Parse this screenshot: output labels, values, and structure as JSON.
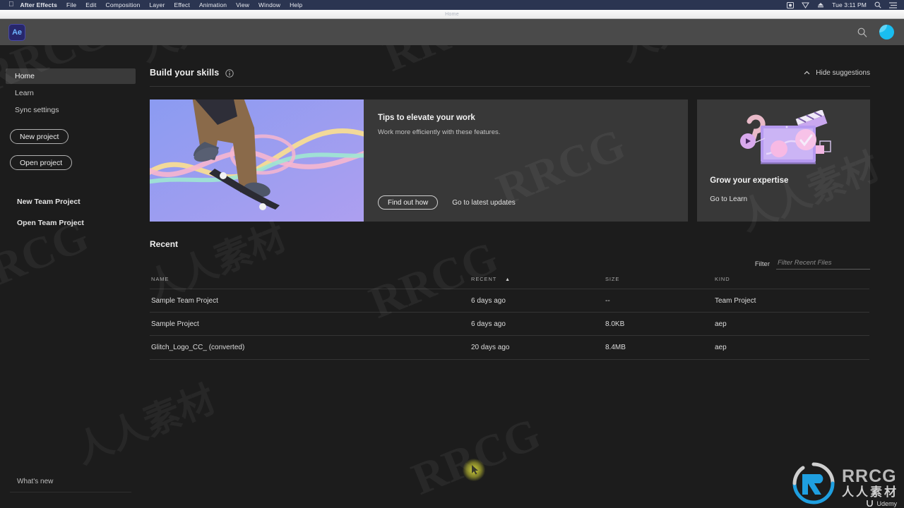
{
  "macbar": {
    "apple_icon": "apple-icon",
    "app_name": "After Effects",
    "menus": [
      "File",
      "Edit",
      "Composition",
      "Layer",
      "Effect",
      "Animation",
      "View",
      "Window",
      "Help"
    ],
    "status_icons": [
      "screen-record-icon",
      "shield-icon",
      "eject-icon"
    ],
    "clock": "Tue 3:11 PM",
    "right_icons": [
      "spotlight-search-icon",
      "control-center-icon"
    ]
  },
  "window": {
    "title": "Home"
  },
  "toolbar": {
    "logo_text": "Ae",
    "search_icon": "search-icon",
    "avatar": "user-avatar"
  },
  "sidebar": {
    "items": [
      {
        "label": "Home",
        "active": true
      },
      {
        "label": "Learn",
        "active": false
      },
      {
        "label": "Sync settings",
        "active": false
      }
    ],
    "buttons": [
      {
        "label": "New project"
      },
      {
        "label": "Open project"
      }
    ],
    "team_links": [
      {
        "label": "New Team Project"
      },
      {
        "label": "Open Team Project"
      }
    ],
    "whats_new": "What's new"
  },
  "suggestions": {
    "title": "Build your skills",
    "info_icon": "info-icon",
    "hide_label": "Hide suggestions",
    "hide_icon": "chevron-up-icon",
    "tips_card": {
      "title": "Tips to elevate your work",
      "subtitle": "Work more efficiently with these features.",
      "primary_button": "Find out how",
      "secondary_link": "Go to latest updates",
      "hero_alt": "skateboarder-hero-image"
    },
    "grow_card": {
      "title": "Grow your expertise",
      "link": "Go to Learn",
      "art_alt": "learning-illustration"
    }
  },
  "recent": {
    "heading": "Recent",
    "filter_label": "Filter",
    "filter_placeholder": "Filter Recent Files",
    "filter_value": "",
    "columns": [
      "NAME",
      "RECENT",
      "SIZE",
      "KIND"
    ],
    "sort_column": "RECENT",
    "sort_icon": "sort-asc-icon",
    "rows": [
      {
        "name": "Sample Team Project",
        "recent": "6 days ago",
        "size": "--",
        "kind": "Team Project"
      },
      {
        "name": "Sample Project",
        "recent": "6 days ago",
        "size": "8.0KB",
        "kind": "aep"
      },
      {
        "name": "Glitch_Logo_CC_ (converted)",
        "recent": "20 days ago",
        "size": "8.4MB",
        "kind": "aep"
      }
    ]
  },
  "watermark": {
    "brand": "RRCG",
    "brand_cn": "人人素材",
    "udemy": "Udemy",
    "tiles": [
      "RRCG",
      "人人素材",
      "RRCG",
      "人人素材",
      "RRCG",
      "人人素材",
      "RRCG",
      "人人素材",
      "RRCG",
      "人人素材",
      "RRCG"
    ]
  },
  "colors": {
    "accent_blue": "#19bdf0",
    "logo_navy": "#27276b",
    "panel": "#383838",
    "background": "#1c1c1c",
    "toolbar": "#4a4a4a",
    "menubar": "#2b3551",
    "cursor_glow": "#dede3c"
  }
}
